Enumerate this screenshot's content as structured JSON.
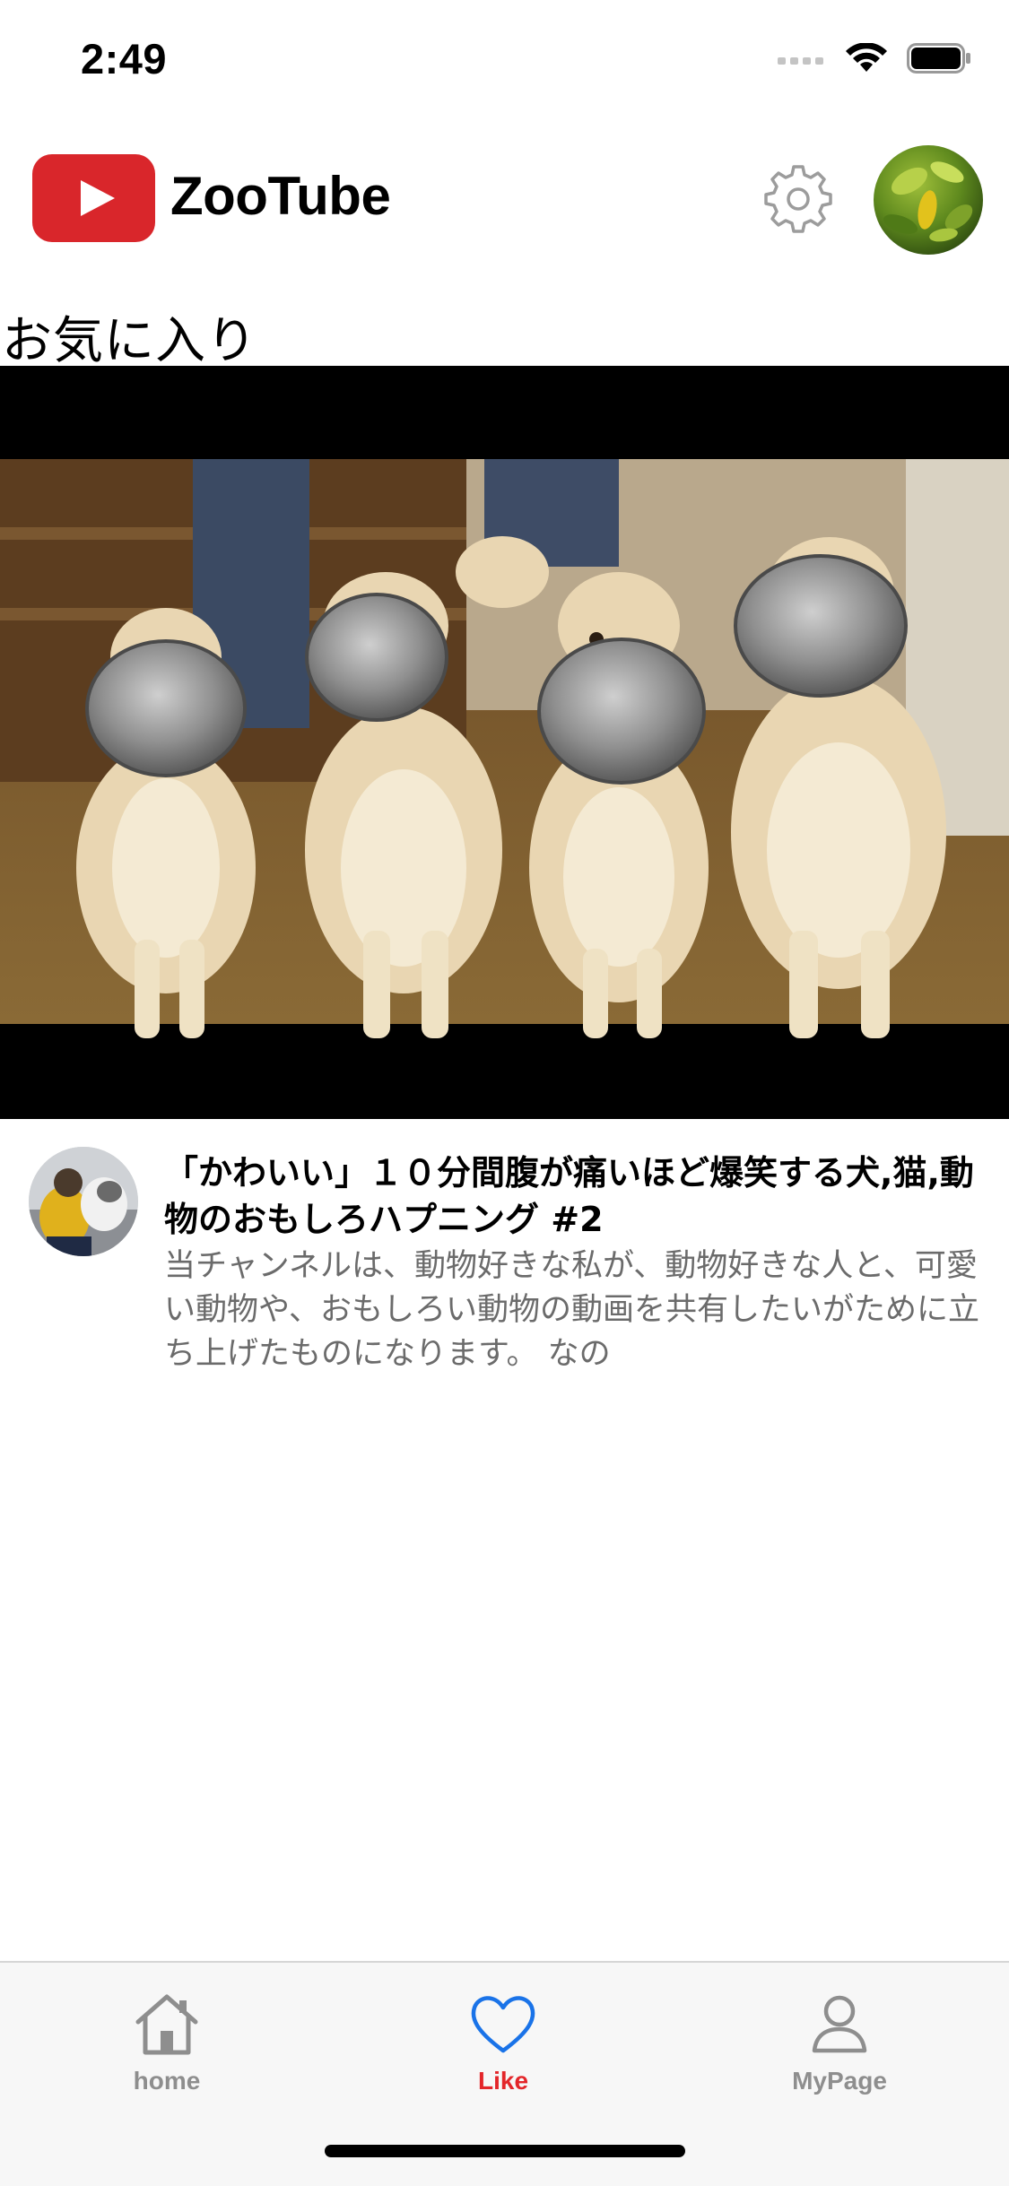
{
  "status_bar": {
    "time": "2:49"
  },
  "header": {
    "app_title": "ZooTube",
    "logo_icon": "youtube-play-logo",
    "settings_icon": "gear-icon",
    "profile_icon": "avatar"
  },
  "section": {
    "title": "お気に入り"
  },
  "video": {
    "title": "「かわいい」１０分間腹が痛いほど爆笑する犬,猫,動物のおもしろハプニング #2",
    "description": "当チャンネルは、動物好きな私が、動物好きな人と、可愛い動物や、おもしろい動物の動画を共有したいがために立ち上げたものになります。 なの"
  },
  "tabs": [
    {
      "label": "home",
      "icon": "home-icon",
      "active": false
    },
    {
      "label": "Like",
      "icon": "heart-icon",
      "active": true
    },
    {
      "label": "MyPage",
      "icon": "person-icon",
      "active": false
    }
  ],
  "colors": {
    "brand_red": "#d9262b",
    "active_icon_blue": "#1a73e8",
    "active_label_red": "#e3262a",
    "inactive_gray": "#8e8e8e",
    "tab_bar_bg": "#f7f7f7"
  }
}
